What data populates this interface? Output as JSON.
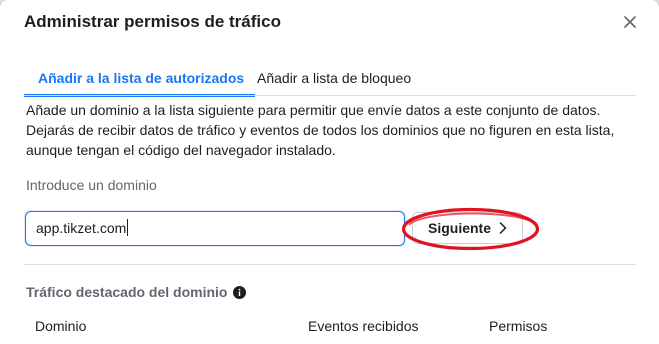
{
  "modal": {
    "title": "Administrar permisos de tráfico",
    "close_icon": "close-icon"
  },
  "tabs": [
    {
      "label": "Añadir a la lista de autorizados",
      "active": true
    },
    {
      "label": "Añadir a lista de bloqueo",
      "active": false
    }
  ],
  "description": {
    "line1": "Añade un dominio a la lista siguiente para permitir que envíe datos a este conjunto de datos.",
    "line2": "Dejarás de recibir datos de tráfico y eventos de todos los dominios que no figuren en esta lista,",
    "line3": "aunque tengan el código del navegador instalado."
  },
  "domain_input": {
    "label": "Introduce un dominio",
    "value": "app.tikzet.com"
  },
  "next_button": {
    "label": "Siguiente",
    "icon": "chevron-right-icon"
  },
  "annotation": {
    "color": "#e0141e",
    "shape": "ellipse"
  },
  "featured_traffic": {
    "title": "Tráfico destacado del dominio",
    "info_icon": "info-icon",
    "columns": [
      "Dominio",
      "Eventos recibidos",
      "Permisos"
    ]
  },
  "colors": {
    "accent": "#1877f2",
    "text": "#1c1e21",
    "muted": "#606770",
    "border": "#dadde1"
  }
}
